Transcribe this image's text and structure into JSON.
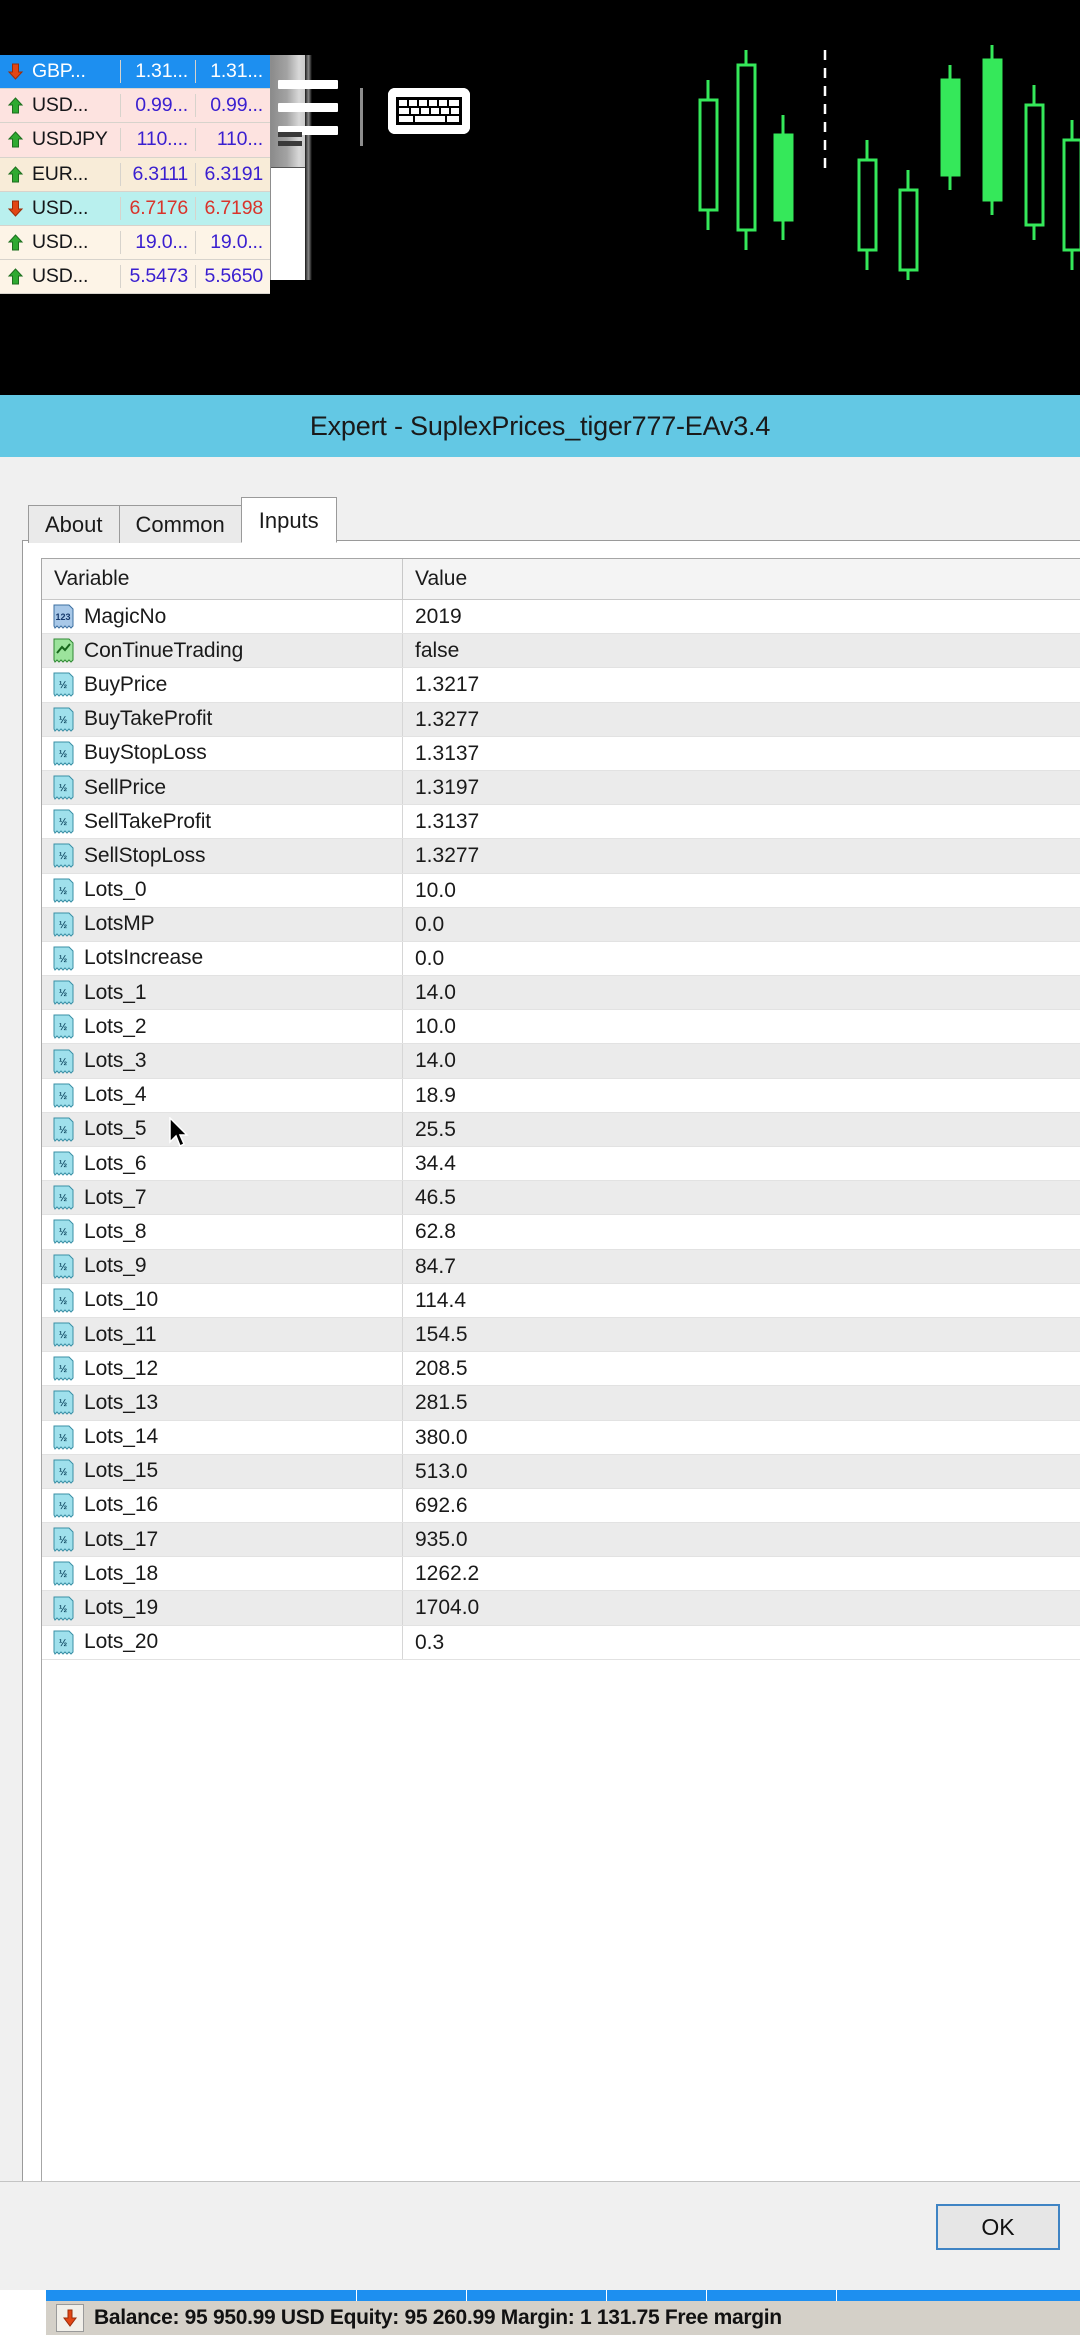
{
  "market_watch": {
    "rows": [
      {
        "dir": "down",
        "symbol": "GBP...",
        "bid": "1.31...",
        "ask": "1.31...",
        "style": "r-sel"
      },
      {
        "dir": "up",
        "symbol": "USD...",
        "bid": "0.99...",
        "ask": "0.99...",
        "style": "r-pink"
      },
      {
        "dir": "up",
        "symbol": "USDJPY",
        "bid": "110....",
        "ask": "110...",
        "style": "r-pink"
      },
      {
        "dir": "up",
        "symbol": "EUR...",
        "bid": "6.3111",
        "ask": "6.3191",
        "style": "r-cream"
      },
      {
        "dir": "down",
        "symbol": "USD...",
        "bid": "6.7176",
        "ask": "6.7198",
        "style": "r-cyan"
      },
      {
        "dir": "up",
        "symbol": "USD...",
        "bid": "19.0...",
        "ask": "19.0...",
        "style": "r-white"
      },
      {
        "dir": "up",
        "symbol": "USD...",
        "bid": "5.5473",
        "ask": "5.5650",
        "style": "r-white"
      }
    ]
  },
  "toolbar": {
    "menu_icon": "hamburger-menu-icon",
    "keyboard_icon": "keyboard-icon"
  },
  "dialog": {
    "title": "Expert - SuplexPrices_tiger777-EAv3.4",
    "tabs": [
      {
        "label": "About",
        "active": false
      },
      {
        "label": "Common",
        "active": false
      },
      {
        "label": "Inputs",
        "active": true
      }
    ],
    "grid": {
      "columns": [
        "Variable",
        "Value"
      ],
      "rows": [
        {
          "icon": "int",
          "name": "MagicNo",
          "value": "2019"
        },
        {
          "icon": "bool",
          "name": "ConTinueTrading",
          "value": "false"
        },
        {
          "icon": "double",
          "name": "BuyPrice",
          "value": "1.3217"
        },
        {
          "icon": "double",
          "name": "BuyTakeProfit",
          "value": "1.3277"
        },
        {
          "icon": "double",
          "name": "BuyStopLoss",
          "value": "1.3137"
        },
        {
          "icon": "double",
          "name": "SellPrice",
          "value": "1.3197"
        },
        {
          "icon": "double",
          "name": "SellTakeProfit",
          "value": "1.3137"
        },
        {
          "icon": "double",
          "name": "SellStopLoss",
          "value": "1.3277"
        },
        {
          "icon": "double",
          "name": "Lots_0",
          "value": "10.0"
        },
        {
          "icon": "double",
          "name": "LotsMP",
          "value": "0.0"
        },
        {
          "icon": "double",
          "name": "LotsIncrease",
          "value": "0.0"
        },
        {
          "icon": "double",
          "name": "Lots_1",
          "value": "14.0"
        },
        {
          "icon": "double",
          "name": "Lots_2",
          "value": "10.0"
        },
        {
          "icon": "double",
          "name": "Lots_3",
          "value": "14.0"
        },
        {
          "icon": "double",
          "name": "Lots_4",
          "value": "18.9"
        },
        {
          "icon": "double",
          "name": "Lots_5",
          "value": "25.5"
        },
        {
          "icon": "double",
          "name": "Lots_6",
          "value": "34.4"
        },
        {
          "icon": "double",
          "name": "Lots_7",
          "value": "46.5"
        },
        {
          "icon": "double",
          "name": "Lots_8",
          "value": "62.8"
        },
        {
          "icon": "double",
          "name": "Lots_9",
          "value": "84.7"
        },
        {
          "icon": "double",
          "name": "Lots_10",
          "value": "114.4"
        },
        {
          "icon": "double",
          "name": "Lots_11",
          "value": "154.5"
        },
        {
          "icon": "double",
          "name": "Lots_12",
          "value": "208.5"
        },
        {
          "icon": "double",
          "name": "Lots_13",
          "value": "281.5"
        },
        {
          "icon": "double",
          "name": "Lots_14",
          "value": "380.0"
        },
        {
          "icon": "double",
          "name": "Lots_15",
          "value": "513.0"
        },
        {
          "icon": "double",
          "name": "Lots_16",
          "value": "692.6"
        },
        {
          "icon": "double",
          "name": "Lots_17",
          "value": "935.0"
        },
        {
          "icon": "double",
          "name": "Lots_18",
          "value": "1262.2"
        },
        {
          "icon": "double",
          "name": "Lots_19",
          "value": "1704.0"
        },
        {
          "icon": "double",
          "name": "Lots_20",
          "value": "0.3"
        }
      ]
    },
    "ok_label": "OK"
  },
  "status_bar": {
    "text": "Balance: 95 950.99 USD  Equity: 95 260.99  Margin: 1 131.75  Free margin",
    "icon": "down-arrow-icon"
  },
  "colors": {
    "title_bar": "#63c8e4",
    "selection": "#1d8ff0",
    "accent_button_border": "#3f84c4"
  }
}
